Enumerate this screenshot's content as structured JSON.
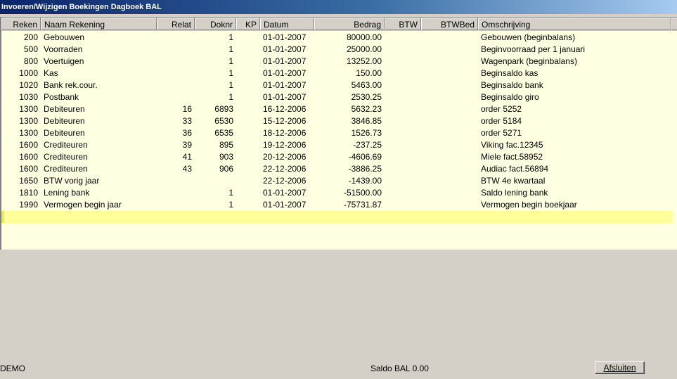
{
  "window": {
    "title": "Invoeren/Wijzigen Boekingen Dagboek BAL"
  },
  "grid": {
    "columns": [
      "Reken",
      "Naam Rekening",
      "Relat",
      "Doknr",
      "KP",
      "Datum",
      "Bedrag",
      "BTW",
      "BTWBed",
      "Omschrijving"
    ],
    "rows": [
      [
        "200",
        "Gebouwen",
        "",
        "1",
        "",
        "01-01-2007",
        "80000.00",
        "",
        "",
        "Gebouwen (beginbalans)"
      ],
      [
        "500",
        "Voorraden",
        "",
        "1",
        "",
        "01-01-2007",
        "25000.00",
        "",
        "",
        "Beginvoorraad per 1 januari"
      ],
      [
        "800",
        "Voertuigen",
        "",
        "1",
        "",
        "01-01-2007",
        "13252.00",
        "",
        "",
        "Wagenpark (beginbalans)"
      ],
      [
        "1000",
        "Kas",
        "",
        "1",
        "",
        "01-01-2007",
        "150.00",
        "",
        "",
        "Beginsaldo kas"
      ],
      [
        "1020",
        "Bank rek.cour.",
        "",
        "1",
        "",
        "01-01-2007",
        "5463.00",
        "",
        "",
        "Beginsaldo bank"
      ],
      [
        "1030",
        "Postbank",
        "",
        "1",
        "",
        "01-01-2007",
        "2530.25",
        "",
        "",
        "Beginsaldo giro"
      ],
      [
        "1300",
        "Debiteuren",
        "16",
        "6893",
        "",
        "16-12-2006",
        "5632.23",
        "",
        "",
        "order 5252"
      ],
      [
        "1300",
        "Debiteuren",
        "33",
        "6530",
        "",
        "15-12-2006",
        "3846.85",
        "",
        "",
        "order 5184"
      ],
      [
        "1300",
        "Debiteuren",
        "36",
        "6535",
        "",
        "18-12-2006",
        "1526.73",
        "",
        "",
        "order 5271"
      ],
      [
        "1600",
        "Crediteuren",
        "39",
        "895",
        "",
        "19-12-2006",
        "-237.25",
        "",
        "",
        "Viking fac.12345"
      ],
      [
        "1600",
        "Crediteuren",
        "41",
        "903",
        "",
        "20-12-2006",
        "-4606.69",
        "",
        "",
        "Miele fact.58952"
      ],
      [
        "1600",
        "Crediteuren",
        "43",
        "906",
        "",
        "22-12-2006",
        "-3886.25",
        "",
        "",
        "Audiac fact.56894"
      ],
      [
        "1650",
        "BTW vorig jaar",
        "",
        "",
        "",
        "22-12-2006",
        "-1439.00",
        "",
        "",
        "BTW 4e kwartaal"
      ],
      [
        "1810",
        "Lening bank",
        "",
        "1",
        "",
        "01-01-2007",
        "-51500.00",
        "",
        "",
        "Saldo lening bank"
      ],
      [
        "1990",
        "Vermogen begin jaar",
        "",
        "1",
        "",
        "01-01-2007",
        "-75731.87",
        "",
        "",
        "Vermogen begin boekjaar"
      ]
    ]
  },
  "status": {
    "company": "DEMO",
    "saldo_label": "Saldo  BAL  0.00"
  },
  "buttons": {
    "close": "Afsluiten"
  }
}
